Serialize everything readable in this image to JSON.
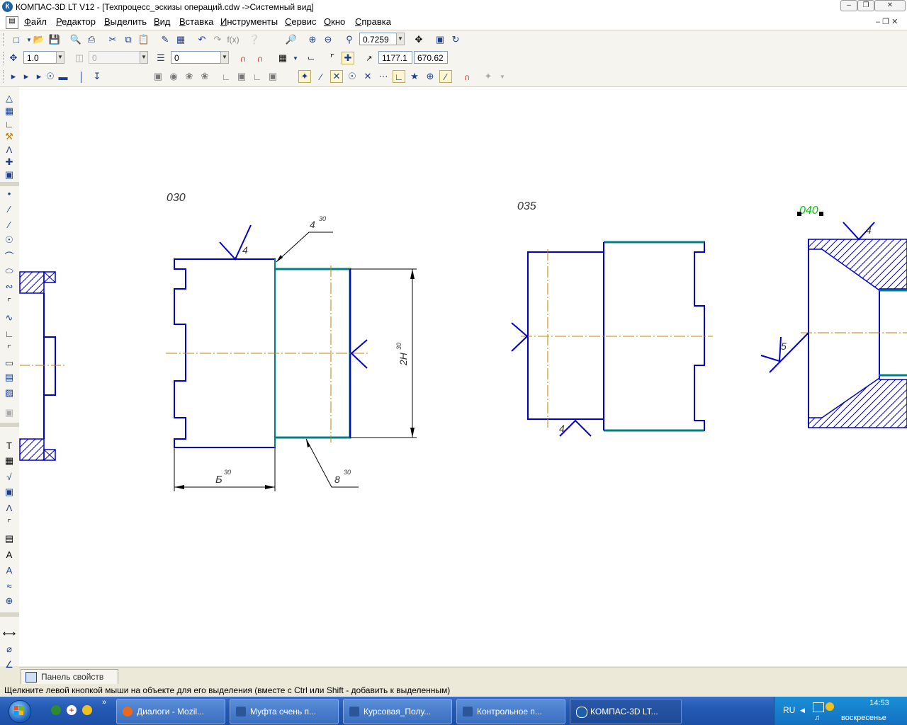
{
  "window": {
    "title": "КОМПАС-3D LT V12 - [Техпроцесс_эскизы операций.cdw ->Системный вид]",
    "app_icon": "К",
    "controls": [
      "minimize",
      "maximize",
      "close"
    ]
  },
  "menu": {
    "items": [
      "Файл",
      "Редактор",
      "Выделить",
      "Вид",
      "Вставка",
      "Инструменты",
      "Сервис",
      "Окно",
      "Справка"
    ]
  },
  "toolbar1": {
    "zoom_value": "0.7259"
  },
  "toolbar2": {
    "step_value": "1.0",
    "angle_value": "0",
    "layer_value": "0",
    "coord_x": "1177.1",
    "coord_y": "670.62"
  },
  "drawing": {
    "labels": {
      "op030": "030",
      "op035": "035",
      "op040": "040",
      "rough_4a": "4",
      "rough_4b": "4",
      "rough_4c": "4",
      "rough_5": "5",
      "dim_4_30": "4",
      "dim_4_30_sup": "30",
      "dim_B_30": "Б",
      "dim_B_30_sup": "30",
      "dim_8_30": "8",
      "dim_8_30_sup": "30",
      "dim_2H_30": "2H",
      "dim_2H_30_sup": "30"
    },
    "colors": {
      "outline": "#0000cc",
      "machined": "#008080",
      "axis": "#c08000",
      "dimension": "#000000",
      "selected_text": "#00cc00"
    }
  },
  "property_panel": {
    "tab_label": "Панель свойств"
  },
  "status_text": "Щелкните левой кнопкой мыши на объекте для его выделения (вместе с Ctrl или Shift - добавить к выделенным)",
  "taskbar": {
    "items": [
      {
        "label": "Диалоги - Mozil...",
        "icon_color": "#e86a1a"
      },
      {
        "label": "Муфта очень п...",
        "icon_color": "#2b579a"
      },
      {
        "label": "Курсовая_Полу...",
        "icon_color": "#2b579a"
      },
      {
        "label": "Контрольное п...",
        "icon_color": "#2b579a"
      },
      {
        "label": "КОМПАС-3D LT...",
        "icon_color": "#1d5fa8"
      }
    ],
    "language": "RU",
    "time": "14:53",
    "day": "воскресенье"
  }
}
